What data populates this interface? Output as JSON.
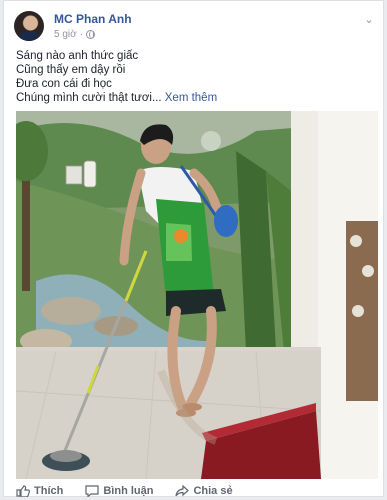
{
  "post": {
    "author": "MC Phan Anh",
    "time": "5 giờ",
    "lines": [
      "Sáng nào anh thức giấc",
      "Cũng thấy em dậy rồi",
      "Đưa con cái đi học",
      "Chúng mình cười thật tươi"
    ],
    "ellipsis": "...",
    "see_more": "Xem thêm"
  },
  "actions": {
    "like": "Thích",
    "comment": "Bình luận",
    "share": "Chia sẻ"
  },
  "icons": {
    "privacy": "globe-icon",
    "menu": "chevron-down-icon",
    "like": "thumbs-up-icon",
    "comment": "comment-icon",
    "share": "share-icon"
  }
}
